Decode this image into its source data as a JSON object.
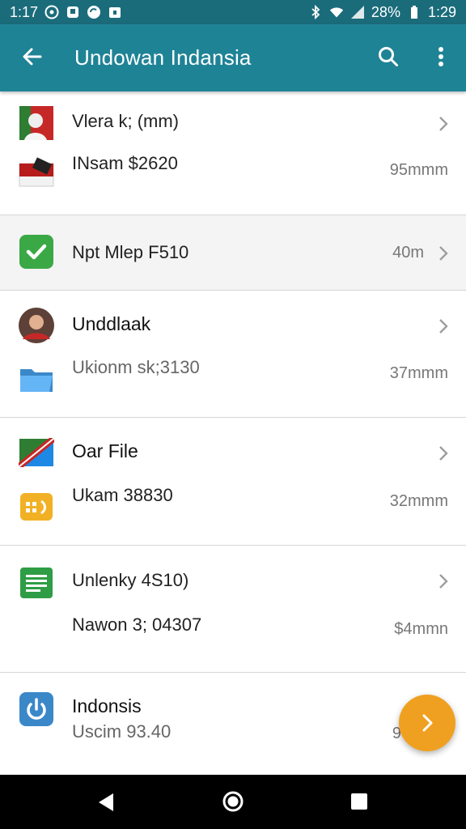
{
  "status_bar": {
    "time_left": "1:17",
    "battery": "28%",
    "time_right": "1:29"
  },
  "app_bar": {
    "title": "Undowan Indansia"
  },
  "rows": [
    {
      "line1": "Vlera  k; (mm)",
      "line2": "INsam $2620",
      "meta": "95mmm"
    },
    {
      "line1": "Npt Mlep F510",
      "meta": "40m"
    },
    {
      "line1": "Unddlaak",
      "line2": "Ukionm sk;3130",
      "meta": "37mmm"
    },
    {
      "line1": "Oar File",
      "line2": "Ukam 38830",
      "meta": "32mmm"
    },
    {
      "line1": "Unlenky 4S10)",
      "line2": "Nawon 3; 04307",
      "meta": "$4mmn"
    },
    {
      "line1": "Indonsis",
      "line2": "Uscim 93.40",
      "meta": "9"
    }
  ],
  "colors": {
    "status_bar": "#1b6c7b",
    "app_bar": "#1f8396",
    "fab": "#f0a020",
    "green_icon": "#3aa845",
    "blue_icon": "#3b88c9"
  },
  "icons": {
    "back": "arrow-left-icon",
    "search": "search-icon",
    "more": "more-vert-icon",
    "chevron": "chevron-right-icon",
    "fab": "chevron-right-icon"
  }
}
